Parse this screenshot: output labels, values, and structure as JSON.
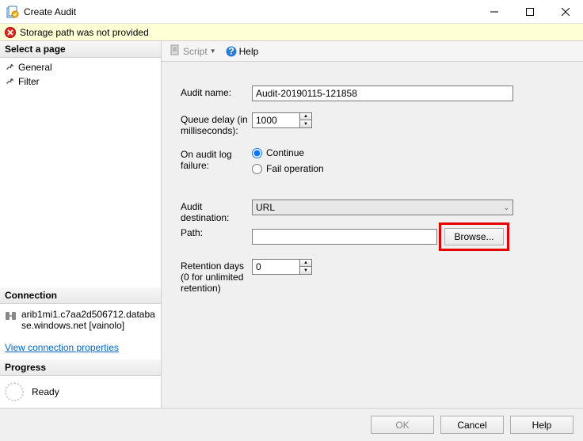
{
  "window": {
    "title": "Create Audit"
  },
  "error": {
    "message": "Storage path was not provided"
  },
  "left_panel": {
    "select_page": {
      "header": "Select a page",
      "items": [
        {
          "label": "General"
        },
        {
          "label": "Filter"
        }
      ]
    },
    "connection": {
      "header": "Connection",
      "server": "arib1mi1.c7aa2d506712.database.windows.net [vainolo]",
      "view_props": "View connection properties"
    },
    "progress": {
      "header": "Progress",
      "status": "Ready"
    }
  },
  "toolbar": {
    "script": "Script",
    "help": "Help"
  },
  "form": {
    "audit_name_label": "Audit name:",
    "audit_name_value": "Audit-20190115-121858",
    "queue_delay_label": "Queue delay (in milliseconds):",
    "queue_delay_value": "1000",
    "on_failure_label": "On audit log failure:",
    "on_failure_options": {
      "continue": "Continue",
      "fail": "Fail operation"
    },
    "audit_dest_label": "Audit destination:",
    "audit_dest_value": "URL",
    "path_label": "Path:",
    "path_value": "",
    "browse_label": "Browse...",
    "retention_label": "Retention days (0 for unlimited retention)",
    "retention_value": "0"
  },
  "footer": {
    "ok": "OK",
    "cancel": "Cancel",
    "help": "Help"
  }
}
